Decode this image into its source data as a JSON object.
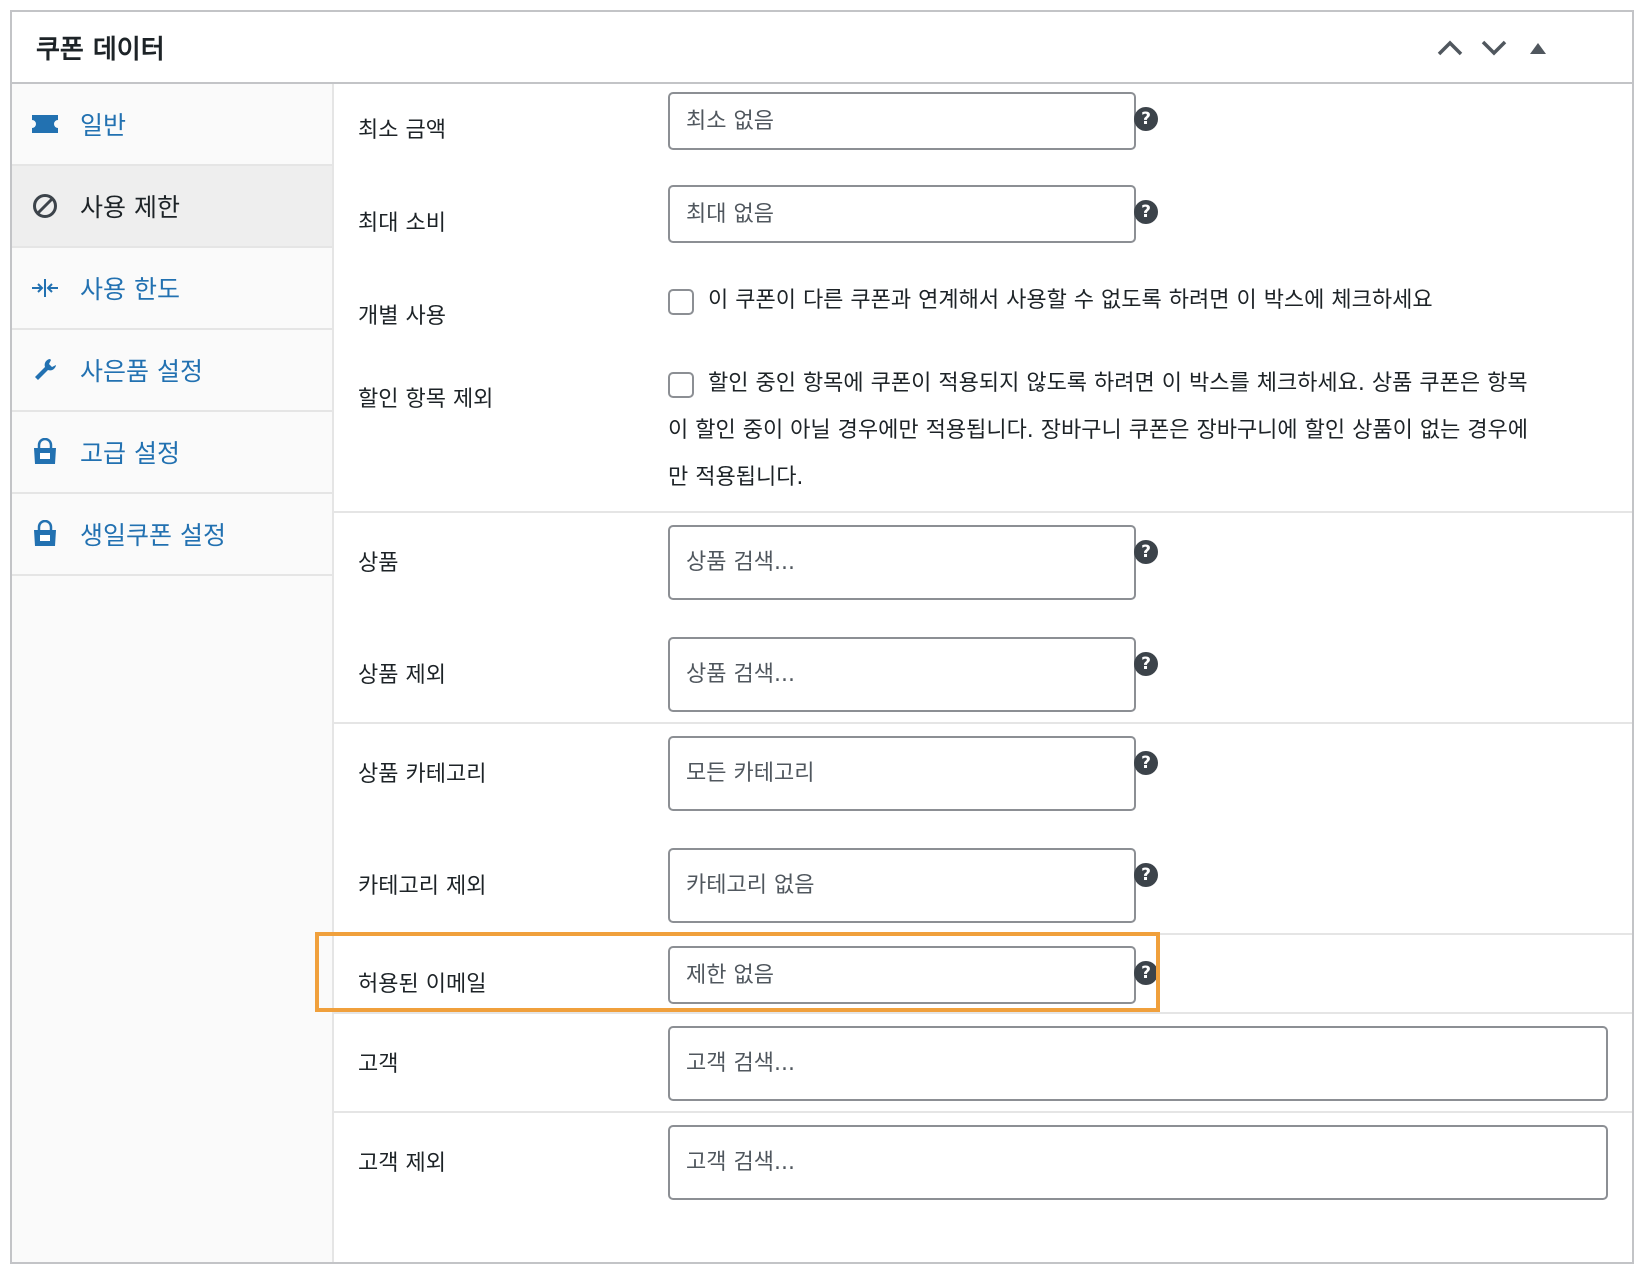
{
  "panel": {
    "title": "쿠폰 데이터"
  },
  "sidebar": {
    "items": [
      {
        "label": "일반",
        "icon": "ticket-icon"
      },
      {
        "label": "사용 제한",
        "icon": "prohibited-icon"
      },
      {
        "label": "사용 한도",
        "icon": "arrows-in-icon"
      },
      {
        "label": "사은품 설정",
        "icon": "wrench-icon"
      },
      {
        "label": "고급 설정",
        "icon": "shopping-bag-icon"
      },
      {
        "label": "생일쿠폰 설정",
        "icon": "shopping-bag-icon"
      }
    ]
  },
  "fields": {
    "min_amount": {
      "label": "최소 금액",
      "placeholder": "최소 없음"
    },
    "max_spend": {
      "label": "최대 소비",
      "placeholder": "최대 없음"
    },
    "individual_use": {
      "label": "개별 사용",
      "text": "이 쿠폰이 다른 쿠폰과 연계해서 사용할 수 없도록 하려면 이 박스에 체크하세요"
    },
    "exclude_sale": {
      "label": "할인 항목 제외",
      "line1": "할인 중인 항목에 쿠폰이 적용되지 않도록 하려면 이 박스를 체크하세요. 상품 쿠폰은 항목",
      "line2": "이 할인 중이 아닐 경우에만 적용됩니다. 장바구니 쿠폰은 장바구니에 할인 상품이 없는 경우에",
      "line3": "만 적용됩니다."
    },
    "products": {
      "label": "상품",
      "placeholder": "상품 검색..."
    },
    "exclude_products": {
      "label": "상품 제외",
      "placeholder": "상품 검색..."
    },
    "product_categories": {
      "label": "상품 카테고리",
      "placeholder": "모든 카테고리"
    },
    "exclude_categories": {
      "label": "카테고리 제외",
      "placeholder": "카테고리 없음"
    },
    "allowed_emails": {
      "label": "허용된 이메일",
      "placeholder": "제한 없음"
    },
    "customers": {
      "label": "고객",
      "placeholder": "고객 검색..."
    },
    "exclude_customers": {
      "label": "고객 제외",
      "placeholder": "고객 검색..."
    }
  },
  "help_symbol": "?",
  "colors": {
    "accent": "#2271b1",
    "highlight": "#f0a03c",
    "border": "#c3c4c7"
  }
}
